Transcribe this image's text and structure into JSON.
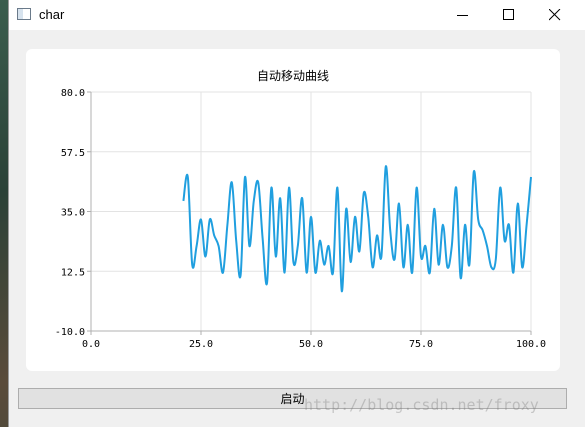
{
  "window": {
    "title": "char",
    "controls": [
      "minimize-icon",
      "maximize-icon",
      "close-icon"
    ]
  },
  "chart_data": {
    "type": "line",
    "title": "自动移动曲线",
    "xlabel": "",
    "ylabel": "",
    "xlim": [
      0,
      100
    ],
    "ylim": [
      -10,
      80
    ],
    "x_ticks": [
      "0.0",
      "25.0",
      "50.0",
      "75.0",
      "100.0"
    ],
    "y_ticks": [
      "-10.0",
      "12.5",
      "35.0",
      "57.5",
      "80.0"
    ],
    "grid": true,
    "line_color": "#209fdf",
    "series": [
      {
        "x": [
          21,
          22,
          23,
          24,
          25,
          26,
          27,
          28,
          29,
          30,
          31,
          32,
          33,
          34,
          35,
          36,
          37,
          38,
          39,
          40,
          41,
          42,
          43,
          44,
          45,
          46,
          47,
          48,
          49,
          50,
          51,
          52,
          53,
          54,
          55,
          56,
          57,
          58,
          59,
          60,
          61,
          62,
          63,
          64,
          65,
          66,
          67,
          68,
          69,
          70,
          71,
          72,
          73,
          74,
          75,
          76,
          77,
          78,
          79,
          80,
          81,
          82,
          83,
          84,
          85,
          86,
          87,
          88,
          89,
          90,
          91,
          92,
          93,
          94,
          95,
          96,
          97,
          98,
          99,
          100
        ],
        "values": [
          39,
          48,
          15,
          22,
          32,
          18,
          32,
          26,
          22,
          12,
          30,
          46,
          24,
          11,
          48,
          22,
          39,
          46,
          25,
          8,
          44,
          18,
          40,
          12,
          44,
          16,
          22,
          40,
          12,
          33,
          12,
          24,
          15,
          22,
          12,
          44,
          5,
          36,
          16,
          33,
          20,
          42,
          33,
          14,
          26,
          18,
          52,
          28,
          17,
          38,
          14,
          30,
          12,
          44,
          18,
          22,
          12,
          36,
          15,
          30,
          14,
          22,
          44,
          10,
          30,
          15,
          50,
          32,
          28,
          22,
          14,
          17,
          44,
          24,
          30,
          12,
          38,
          14,
          30,
          48
        ]
      }
    ]
  },
  "controls": {
    "start_label": "启动"
  },
  "watermark": "http://blog.csdn.net/froxy"
}
